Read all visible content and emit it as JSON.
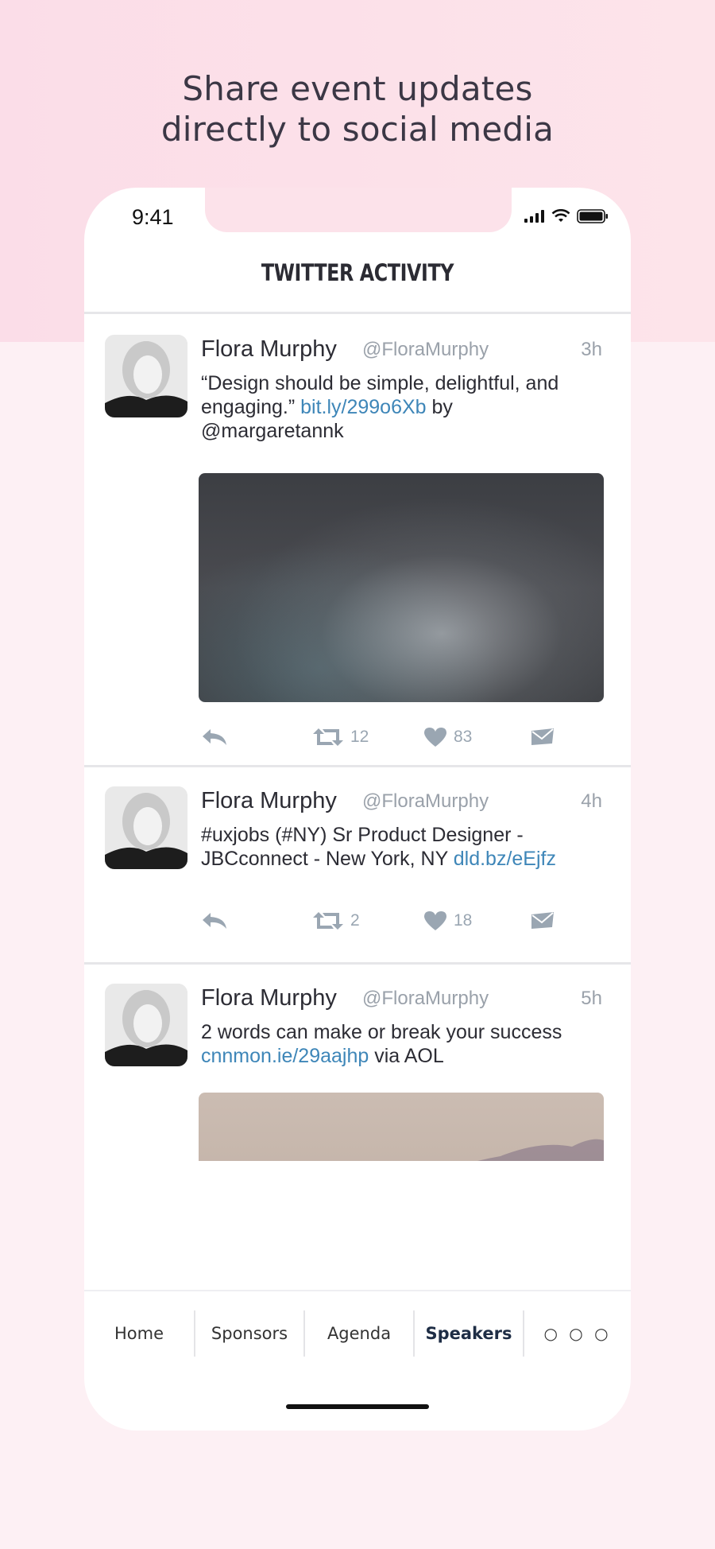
{
  "headline": {
    "line1": "Share event updates",
    "line2": "directly to social media"
  },
  "status_bar": {
    "time": "9:41",
    "icons": [
      "signal-icon",
      "wifi-icon",
      "battery-icon"
    ]
  },
  "nav": {
    "title": "TWITTER ACTIVITY"
  },
  "tweets": [
    {
      "name": "Flora Murphy",
      "handle": "@FloraMurphy",
      "time": "3h",
      "text_before": "“Design should be simple, delightful, and engaging.” ",
      "link": "bit.ly/299o6Xb",
      "text_after": " by @margaretannk",
      "retweets": "12",
      "likes": "83",
      "media": "concert-photo"
    },
    {
      "name": "Flora Murphy",
      "handle": "@FloraMurphy",
      "time": "4h",
      "text_before": "#uxjobs (#NY) Sr Product Designer - JBCconnect - New York, NY ",
      "link": "dld.bz/eEjfz",
      "text_after": "",
      "retweets": "2",
      "likes": "18",
      "media": ""
    },
    {
      "name": "Flora Murphy",
      "handle": "@FloraMurphy",
      "time": "5h",
      "text_before": "2 words can make or break your success ",
      "link": "cnnmon.ie/29aajhp",
      "text_after": " via AOL",
      "retweets": "",
      "likes": "",
      "media": "beach-photo"
    }
  ],
  "tabbar": {
    "items": [
      "Home",
      "Sponsors",
      "Agenda",
      "Speakers"
    ],
    "active": "Speakers",
    "more": "○ ○ ○"
  },
  "colors": {
    "link": "#3e86b8",
    "icon_gray": "#9aa6b2",
    "background_pink": "#fbdde8"
  }
}
